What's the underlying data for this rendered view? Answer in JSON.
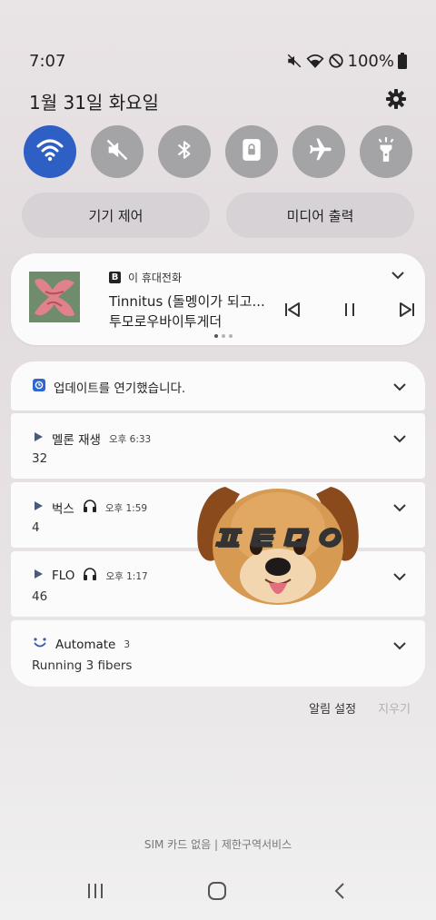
{
  "status": {
    "time": "7:07",
    "battery": "100%"
  },
  "header": {
    "date": "1월 31일 화요일"
  },
  "quick_settings": [
    {
      "name": "wifi",
      "on": true
    },
    {
      "name": "sound-mute",
      "on": false
    },
    {
      "name": "bluetooth",
      "on": false
    },
    {
      "name": "rotation-lock",
      "on": false
    },
    {
      "name": "airplane",
      "on": false
    },
    {
      "name": "flashlight",
      "on": false
    }
  ],
  "pills": {
    "device_control": "기기 제어",
    "media_output": "미디어 출력"
  },
  "media": {
    "source": "이 휴대전화",
    "title": "Tinnitus (돌멩이가 되고...",
    "artist": "투모로우바이투게더"
  },
  "notifications": [
    {
      "app": "업데이트를 연기했습니다.",
      "time": "",
      "count": "",
      "body": ""
    },
    {
      "app": "멜론 재생",
      "time": "오후 6:33",
      "count": "",
      "body": "32"
    },
    {
      "app": "벅스",
      "time": "오후 1:59",
      "count": "",
      "body": "4"
    },
    {
      "app": "FLO",
      "time": "오후 1:17",
      "count": "",
      "body": "46"
    },
    {
      "app": "Automate",
      "time": "",
      "count": "3",
      "body": "Running 3 fibers"
    }
  ],
  "sticker": {
    "text": "ㅍㅌㅁㅇ"
  },
  "footer": {
    "settings": "알림 설정",
    "clear": "지우기",
    "carrier": "SIM 카드 없음 | 제한구역서비스"
  },
  "colors": {
    "accent": "#2e5fc5",
    "tile_off": "#a4a3a6",
    "card": "#fbfbfb"
  }
}
